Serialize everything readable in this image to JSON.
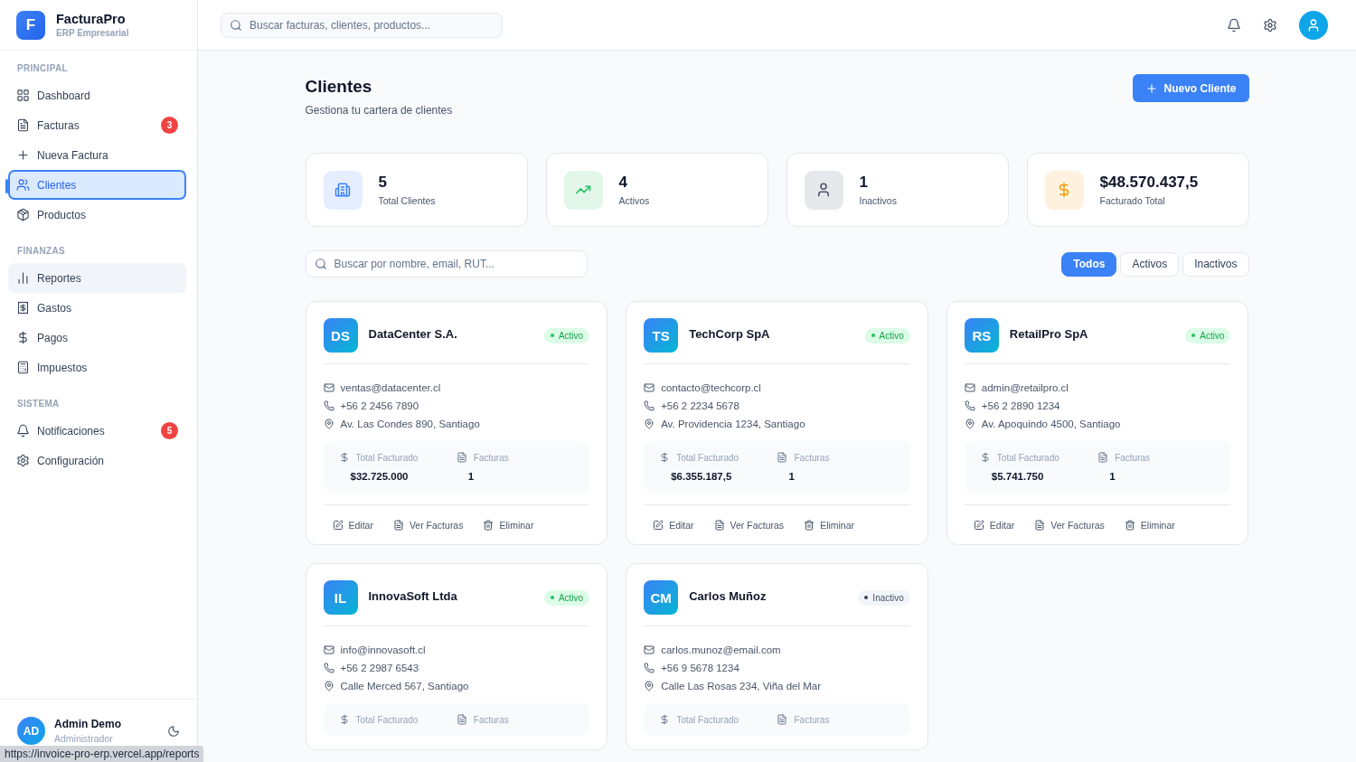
{
  "brand": {
    "logo": "F",
    "name": "FacturaPro",
    "subtitle": "ERP Empresarial"
  },
  "sidebar": {
    "sections": [
      {
        "title": "PRINCIPAL",
        "items": [
          {
            "label": "Dashboard",
            "selected": false,
            "highlighted": false
          },
          {
            "label": "Facturas",
            "selected": false,
            "highlighted": false,
            "badge": "3"
          },
          {
            "label": "Nueva Factura",
            "selected": false,
            "highlighted": false
          },
          {
            "label": "Clientes",
            "selected": true,
            "highlighted": false
          },
          {
            "label": "Productos",
            "selected": false,
            "highlighted": false
          }
        ]
      },
      {
        "title": "FINANZAS",
        "items": [
          {
            "label": "Reportes",
            "selected": false,
            "highlighted": true
          },
          {
            "label": "Gastos",
            "selected": false,
            "highlighted": false
          },
          {
            "label": "Pagos",
            "selected": false,
            "highlighted": false
          },
          {
            "label": "Impuestos",
            "selected": false,
            "highlighted": false
          }
        ]
      },
      {
        "title": "SISTEMA",
        "items": [
          {
            "label": "Notificaciones",
            "selected": false,
            "highlighted": false,
            "badge": "5"
          },
          {
            "label": "Configuración",
            "selected": false,
            "highlighted": false
          }
        ]
      }
    ],
    "user": {
      "initials": "AD",
      "name": "Admin Demo",
      "role": "Administrador"
    }
  },
  "topbar": {
    "search_placeholder": "Buscar facturas, clientes, productos..."
  },
  "page": {
    "title": "Clientes",
    "subtitle": "Gestiona tu cartera de clientes",
    "new_button": "Nuevo Cliente"
  },
  "stats": [
    {
      "value": "5",
      "label": "Total Clientes",
      "color": "#3b82f6"
    },
    {
      "value": "4",
      "label": "Activos",
      "color": "#22c55e"
    },
    {
      "value": "1",
      "label": "Inactivos",
      "color": "#475569"
    },
    {
      "value": "$48.570.437,5",
      "label": "Facturado Total",
      "color": "#f59e0b"
    }
  ],
  "filter": {
    "placeholder": "Buscar por nombre, email, RUT...",
    "tabs": [
      {
        "label": "Todos",
        "selected": true
      },
      {
        "label": "Activos",
        "selected": false
      },
      {
        "label": "Inactivos",
        "selected": false
      }
    ]
  },
  "clients": [
    {
      "initials": "DS",
      "name": "DataCenter S.A.",
      "status": "Activo",
      "active": true,
      "email": "ventas@datacenter.cl",
      "phone": "+56 2 2456 7890",
      "address": "Av. Las Condes 890, Santiago",
      "total_label": "Total Facturado",
      "total": "$32.725.000",
      "count_label": "Facturas",
      "count": "1",
      "actions": [
        "Editar",
        "Ver Facturas",
        "Eliminar"
      ]
    },
    {
      "initials": "TS",
      "name": "TechCorp SpA",
      "status": "Activo",
      "active": true,
      "email": "contacto@techcorp.cl",
      "phone": "+56 2 2234 5678",
      "address": "Av. Providencia 1234, Santiago",
      "total_label": "Total Facturado",
      "total": "$6.355.187,5",
      "count_label": "Facturas",
      "count": "1",
      "actions": [
        "Editar",
        "Ver Facturas",
        "Eliminar"
      ]
    },
    {
      "initials": "RS",
      "name": "RetailPro SpA",
      "status": "Activo",
      "active": true,
      "email": "admin@retailpro.cl",
      "phone": "+56 2 2890 1234",
      "address": "Av. Apoquindo 4500, Santiago",
      "total_label": "Total Facturado",
      "total": "$5.741.750",
      "count_label": "Facturas",
      "count": "1",
      "actions": [
        "Editar",
        "Ver Facturas",
        "Eliminar"
      ]
    },
    {
      "initials": "IL",
      "name": "InnovaSoft Ltda",
      "status": "Activo",
      "active": true,
      "email": "info@innovasoft.cl",
      "phone": "+56 2 2987 6543",
      "address": "Calle Merced 567, Santiago",
      "total_label": "Total Facturado",
      "count_label": "Facturas"
    },
    {
      "initials": "CM",
      "name": "Carlos Muñoz",
      "status": "Inactivo",
      "active": false,
      "email": "carlos.munoz@email.com",
      "phone": "+56 9 5678 1234",
      "address": "Calle Las Rosas 234, Viña del Mar",
      "total_label": "Total Facturado",
      "count_label": "Facturas"
    }
  ],
  "status_url": "https://invoice-pro-erp.vercel.app/reports"
}
